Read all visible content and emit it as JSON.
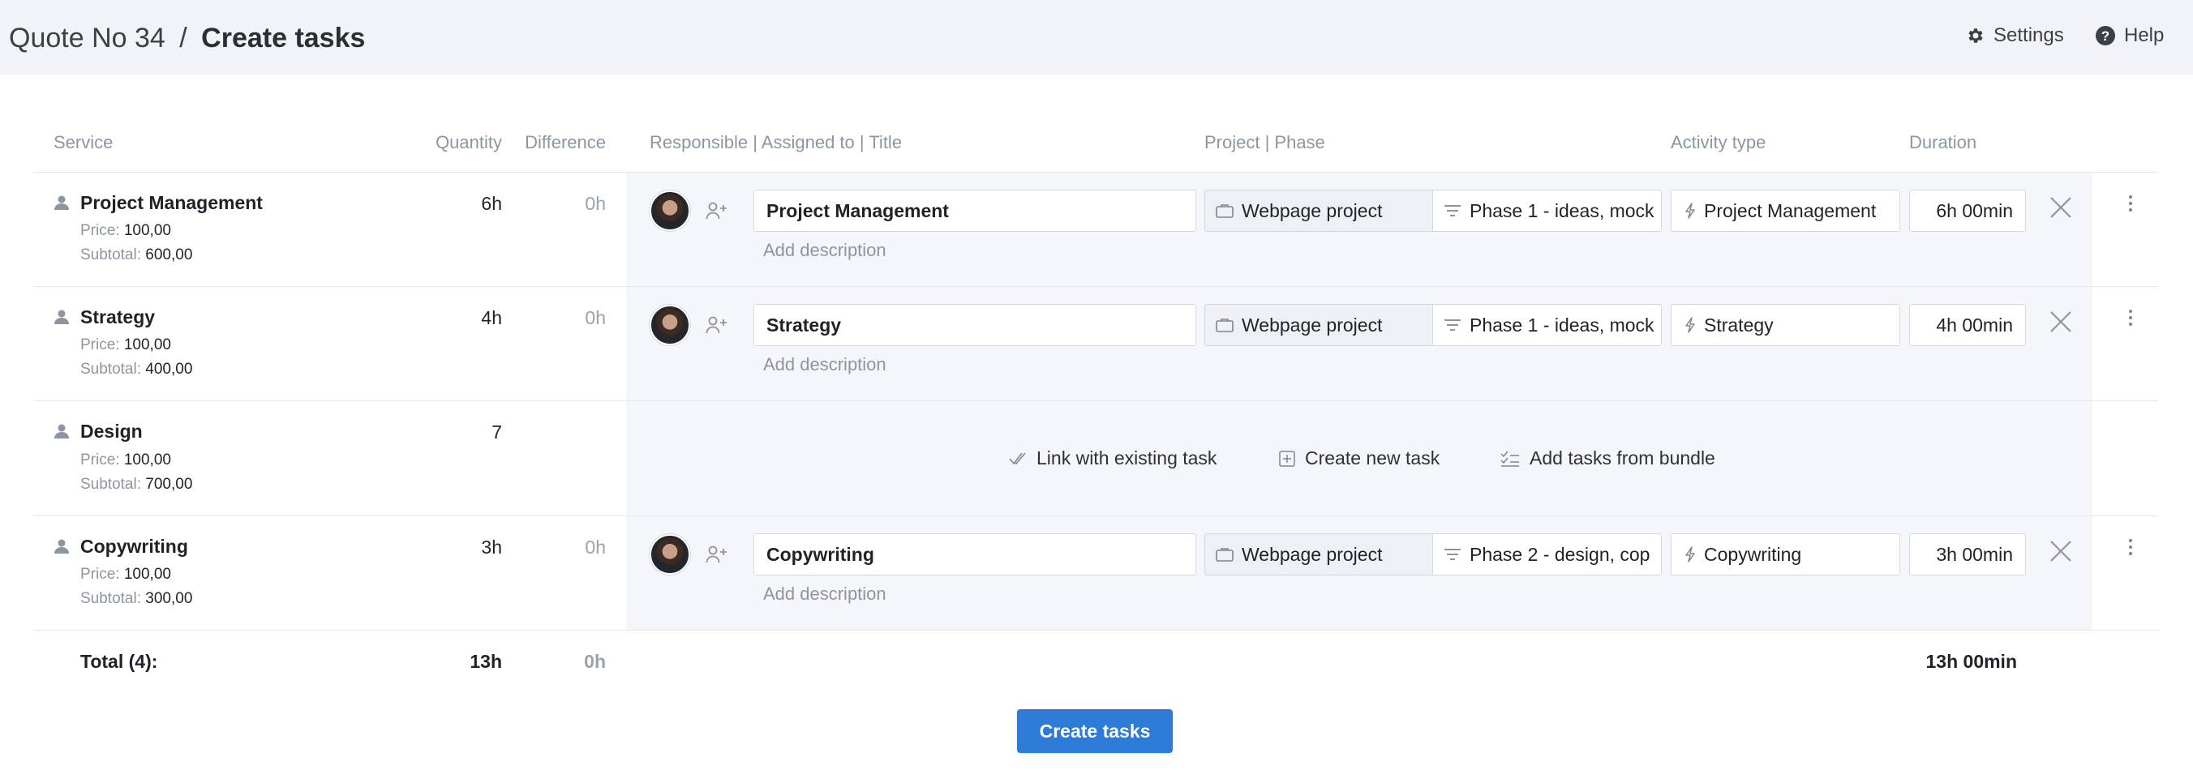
{
  "breadcrumb": {
    "parent": "Quote No 34",
    "separator": "/",
    "current": "Create tasks"
  },
  "top_links": {
    "settings": "Settings",
    "help": "Help"
  },
  "columns": {
    "service": "Service",
    "quantity": "Quantity",
    "difference": "Difference",
    "responsible": "Responsible | Assigned to | Title",
    "project_phase": "Project | Phase",
    "activity_type": "Activity type",
    "duration": "Duration"
  },
  "rows": [
    {
      "service": "Project Management",
      "price_label": "Price:",
      "price": "100,00",
      "subtotal_label": "Subtotal:",
      "subtotal": "600,00",
      "quantity": "6h",
      "difference": "0h",
      "title": "Project Management",
      "description_placeholder": "Add description",
      "project": "Webpage project",
      "phase": "Phase 1 - ideas, mock",
      "activity": "Project Management",
      "duration": "6h 00min"
    },
    {
      "service": "Strategy",
      "price_label": "Price:",
      "price": "100,00",
      "subtotal_label": "Subtotal:",
      "subtotal": "400,00",
      "quantity": "4h",
      "difference": "0h",
      "title": "Strategy",
      "description_placeholder": "Add description",
      "project": "Webpage project",
      "phase": "Phase 1 - ideas, mock",
      "activity": "Strategy",
      "duration": "4h 00min"
    },
    {
      "service": "Design",
      "price_label": "Price:",
      "price": "100,00",
      "subtotal_label": "Subtotal:",
      "subtotal": "700,00",
      "quantity": "7",
      "difference": "",
      "actions": {
        "link_existing": "Link with existing task",
        "create_new": "Create new task",
        "add_bundle": "Add tasks from bundle"
      }
    },
    {
      "service": "Copywriting",
      "price_label": "Price:",
      "price": "100,00",
      "subtotal_label": "Subtotal:",
      "subtotal": "300,00",
      "quantity": "3h",
      "difference": "0h",
      "title": "Copywriting",
      "description_placeholder": "Add description",
      "project": "Webpage project",
      "phase": "Phase 2 - design, cop",
      "activity": "Copywriting",
      "duration": "3h 00min"
    }
  ],
  "totals": {
    "label": "Total (4):",
    "quantity": "13h",
    "difference": "0h",
    "duration": "13h 00min"
  },
  "create_button": "Create tasks",
  "colors": {
    "accent": "#2d7ad7",
    "header_bg": "#f1f3f7",
    "task_area_bg": "#f5f6f9",
    "muted_text": "#8d95a1"
  },
  "icons": {
    "settings": "gear-icon",
    "help": "help-circle-icon",
    "service": "person-icon",
    "assign": "add-user-icon",
    "project": "briefcase-icon",
    "phase": "phase-bars-icon",
    "activity": "lightning-icon",
    "remove": "close-icon",
    "more": "more-vertical-icon",
    "link": "double-check-icon",
    "create": "plus-square-icon",
    "bundle": "checklist-icon"
  }
}
